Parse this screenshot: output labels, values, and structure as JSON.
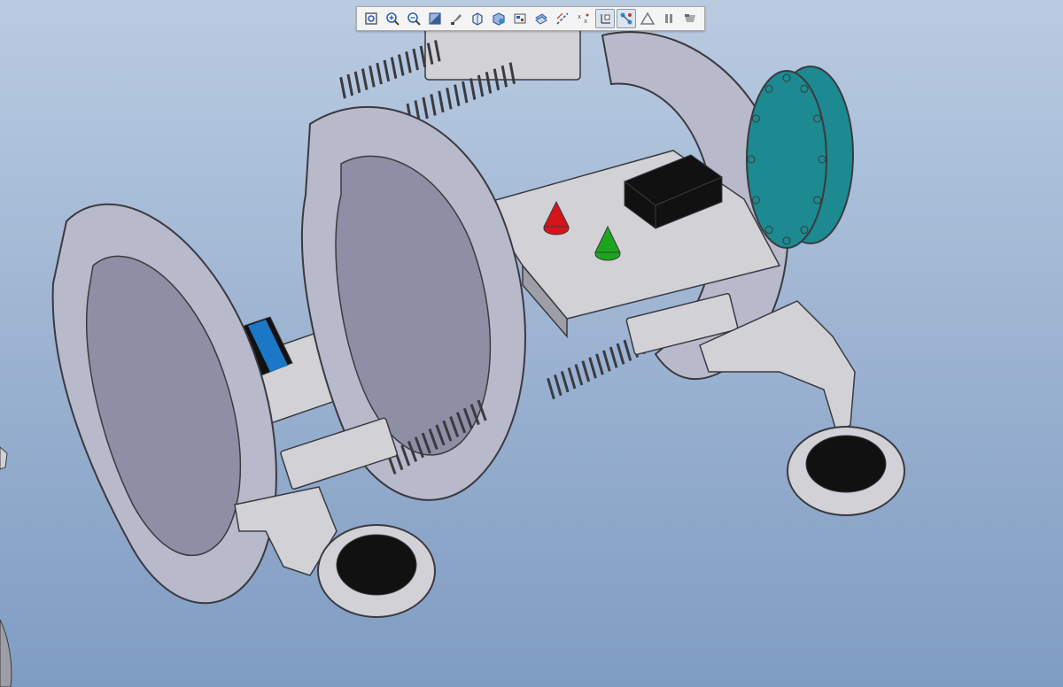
{
  "app": {
    "viewport_colors": {
      "top": "#b9cbe1",
      "bottom": "#7f9cc2"
    }
  },
  "toolbar": {
    "buttons": [
      {
        "icon": "refit-icon",
        "active": false
      },
      {
        "icon": "zoom-in-icon",
        "active": false
      },
      {
        "icon": "zoom-out-icon",
        "active": false
      },
      {
        "icon": "reorient-icon",
        "active": false
      },
      {
        "icon": "repaint-icon",
        "active": false
      },
      {
        "icon": "saved-views-icon",
        "active": false
      },
      {
        "icon": "display-style-icon",
        "active": false
      },
      {
        "icon": "view-manager-icon",
        "active": false
      },
      {
        "icon": "datum-planes-icon",
        "active": false
      },
      {
        "icon": "datum-axes-icon",
        "active": false
      },
      {
        "icon": "datum-points-icon",
        "active": false
      },
      {
        "icon": "coordinate-systems-icon",
        "active": true
      },
      {
        "icon": "annotations-icon",
        "active": true
      },
      {
        "icon": "spin-center-icon",
        "active": false
      },
      {
        "icon": "pause-icon",
        "active": false
      },
      {
        "icon": "flip-icon",
        "active": false
      }
    ]
  },
  "model": {
    "colors": {
      "part": "#d2d2d6",
      "part_dark": "#9e9ea6",
      "ring": "#b9b9cc",
      "ring_dark": "#8e8ea4",
      "motor": "#111111",
      "motor_band": "#1b78c6",
      "wheel_hub": "#1c8a90",
      "red_marker": "#d4141a",
      "green_marker": "#1ea51e",
      "edge": "#3a3a40"
    }
  }
}
